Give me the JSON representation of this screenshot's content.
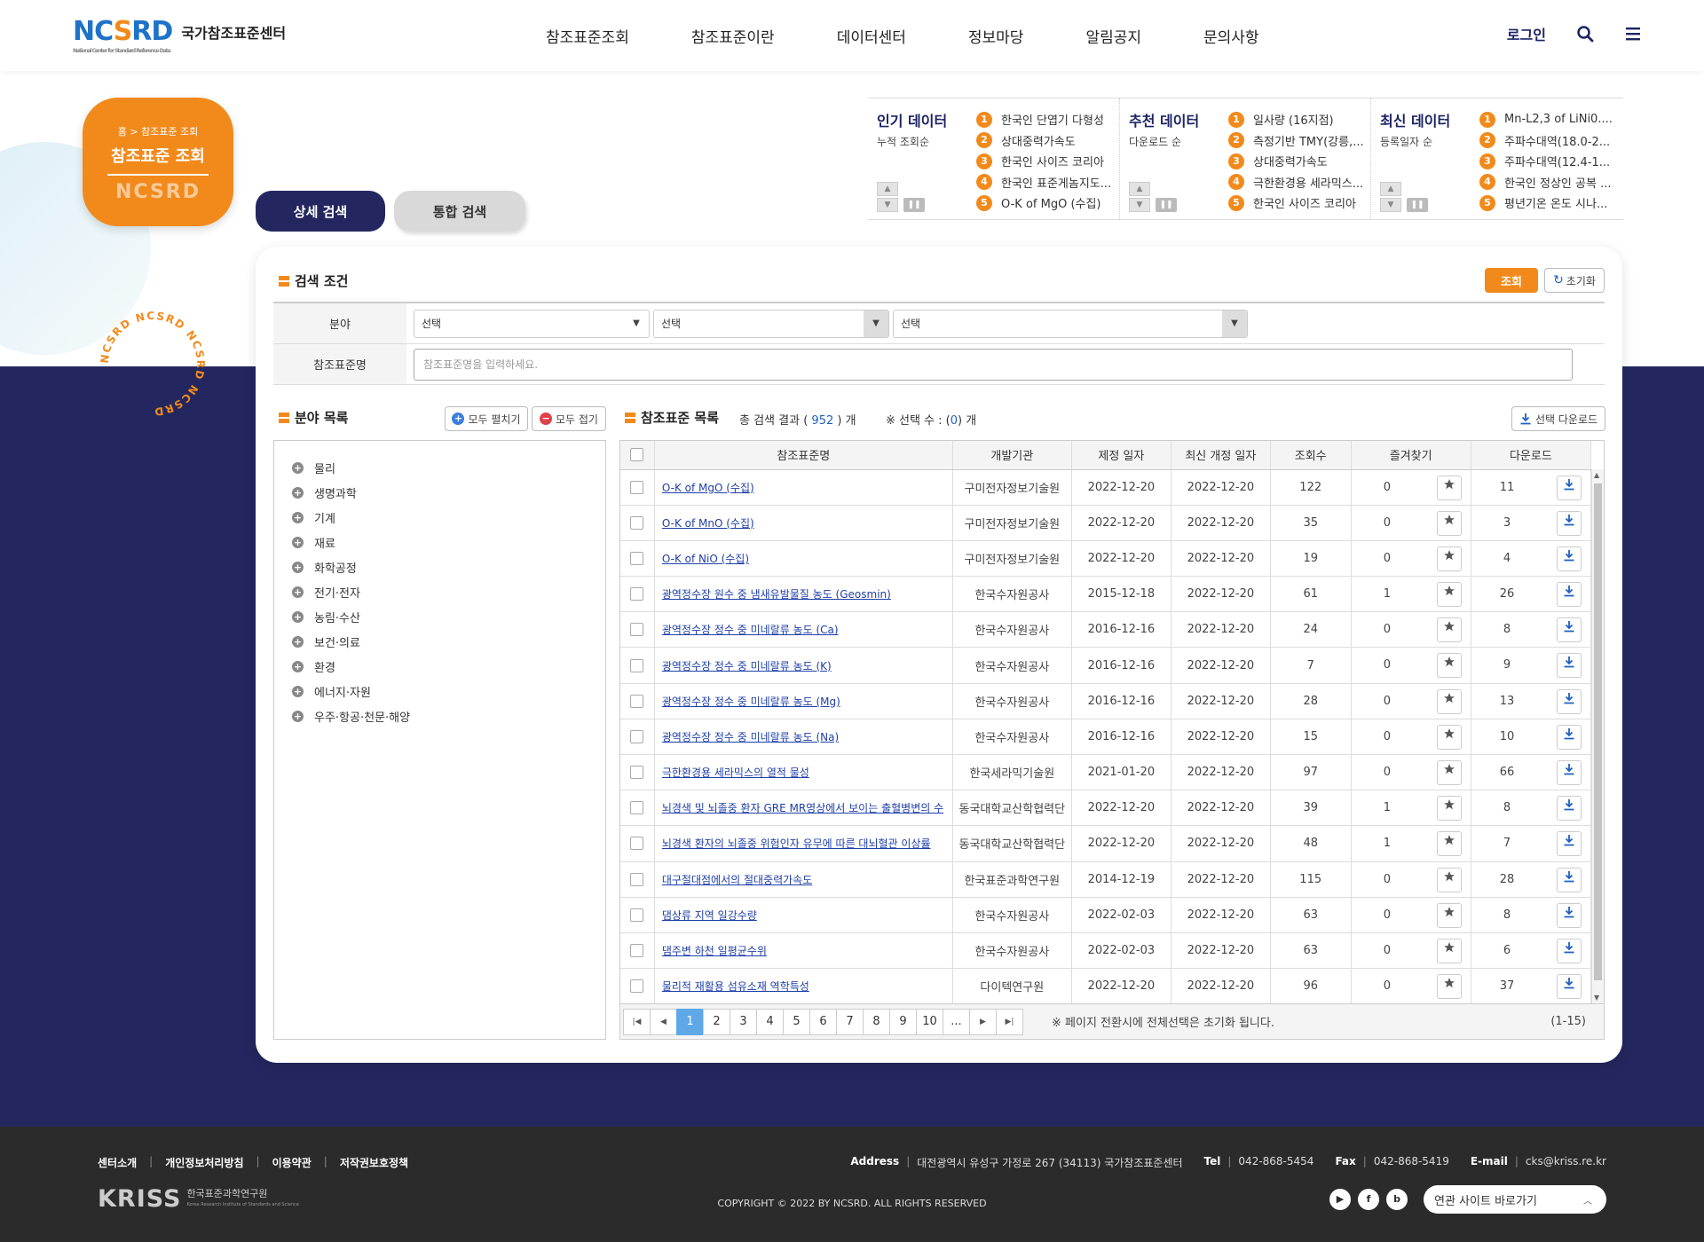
{
  "header": {
    "logo": {
      "text_a": "NC",
      "text_s": "S",
      "text_b": "RD",
      "sub": "National Center for Standard Reference Data",
      "name": "국가참조표준센터"
    },
    "menu": [
      "참조표준조회",
      "참조표준이란",
      "데이터센터",
      "정보마당",
      "알림공지",
      "문의사항"
    ],
    "login": "로그인"
  },
  "location": {
    "home": "홈",
    "current": "참조표준 조회",
    "title": "참조표준 조회",
    "watermark": "NCSRD"
  },
  "stamp_text": "NCSRD NCSRD NCSRD NCSRD",
  "search_tabs": {
    "detail": "상세 검색",
    "integrated": "통합 검색"
  },
  "rankings": [
    {
      "title": "인기 데이터",
      "sub": "누적 조회순",
      "items": [
        "한국인 단엽기 다형성",
        "상대중력가속도",
        "한국인 사이즈 코리아",
        "한국인 표준게놈지도...",
        "O-K of MgO (수집)"
      ]
    },
    {
      "title": "추천 데이터",
      "sub": "다운로드 순",
      "items": [
        "일사량 (16지점)",
        "측정기반 TMY(강릉,...",
        "상대중력가속도",
        "극한환경용 세라믹스...",
        "한국인 사이즈 코리아"
      ]
    },
    {
      "title": "최신 데이터",
      "sub": "등록일자 순",
      "items": [
        "Mn-L2,3 of LiNi0....",
        "주파수대역(18.0-2...",
        "주파수대역(12.4-1...",
        "한국인 정상인 공복 ...",
        "평년기온 온도 시나..."
      ]
    }
  ],
  "ranking_numbers": [
    "1",
    "2",
    "3",
    "4",
    "5"
  ],
  "condition": {
    "title": "검색 조건",
    "search_btn": "조회",
    "reset_btn": "초기화",
    "field_label": "분야",
    "select_values": [
      "선택",
      "선택",
      "선택"
    ],
    "name_label": "참조표준명",
    "name_placeholder": "참조표준명을 입력하세요."
  },
  "field_list": {
    "title": "분야 목록",
    "expand": "모두 펼치기",
    "collapse": "모두 접기",
    "items": [
      "물리",
      "생명과학",
      "기계",
      "재료",
      "화학공정",
      "전기·전자",
      "농림·수산",
      "보건·의료",
      "환경",
      "에너지·자원",
      "우주·항공·천문·해양"
    ]
  },
  "list": {
    "title": "참조표준 목록",
    "total_label": "총 검색 결과 (",
    "total": "952",
    "total_suffix": ") 개",
    "selected_label": "※ 선택 수 : (",
    "selected": "0",
    "selected_suffix": ") 개",
    "download_selected": "선택 다운로드",
    "columns": [
      "참조표준명",
      "개발기관",
      "제정 일자",
      "최신 개정 일자",
      "조회수",
      "즐겨찾기",
      "다운로드"
    ],
    "rows": [
      {
        "name": "O-K of MgO (수집)",
        "org": "구미전자정보기술원",
        "date": "2022-12-20",
        "rev": "2022-12-20",
        "views": "122",
        "fav": "0",
        "dl": "11"
      },
      {
        "name": "O-K of MnO (수집)",
        "org": "구미전자정보기술원",
        "date": "2022-12-20",
        "rev": "2022-12-20",
        "views": "35",
        "fav": "0",
        "dl": "3"
      },
      {
        "name": "O-K of NiO (수집)",
        "org": "구미전자정보기술원",
        "date": "2022-12-20",
        "rev": "2022-12-20",
        "views": "19",
        "fav": "0",
        "dl": "4"
      },
      {
        "name": "광역정수장 원수 중 냄새유발물질 농도 (Geosmin)",
        "org": "한국수자원공사",
        "date": "2015-12-18",
        "rev": "2022-12-20",
        "views": "61",
        "fav": "1",
        "dl": "26"
      },
      {
        "name": "광역정수장 정수 중 미네랄류 농도 (Ca)",
        "org": "한국수자원공사",
        "date": "2016-12-16",
        "rev": "2022-12-20",
        "views": "24",
        "fav": "0",
        "dl": "8"
      },
      {
        "name": "광역정수장 정수 중 미네랄류 농도 (K)",
        "org": "한국수자원공사",
        "date": "2016-12-16",
        "rev": "2022-12-20",
        "views": "7",
        "fav": "0",
        "dl": "9"
      },
      {
        "name": "광역정수장 정수 중 미네랄류 농도 (Mg)",
        "org": "한국수자원공사",
        "date": "2016-12-16",
        "rev": "2022-12-20",
        "views": "28",
        "fav": "0",
        "dl": "13"
      },
      {
        "name": "광역정수장 정수 중 미네랄류 농도 (Na)",
        "org": "한국수자원공사",
        "date": "2016-12-16",
        "rev": "2022-12-20",
        "views": "15",
        "fav": "0",
        "dl": "10"
      },
      {
        "name": "극한환경용 세라믹스의 열적 물성",
        "org": "한국세라믹기술원",
        "date": "2021-01-20",
        "rev": "2022-12-20",
        "views": "97",
        "fav": "0",
        "dl": "66"
      },
      {
        "name": "뇌경색 및 뇌졸중 환자 GRE MR영상에서 보이는 출혈병변의 수",
        "org": "동국대학교산학협력단",
        "date": "2022-12-20",
        "rev": "2022-12-20",
        "views": "39",
        "fav": "1",
        "dl": "8"
      },
      {
        "name": "뇌경색 환자의 뇌졸중 위험인자 유무에 따른 대뇌혈관 이상률",
        "org": "동국대학교산학협력단",
        "date": "2022-12-20",
        "rev": "2022-12-20",
        "views": "48",
        "fav": "1",
        "dl": "7"
      },
      {
        "name": "대구절대점에서의 절대중력가속도",
        "org": "한국표준과학연구원",
        "date": "2014-12-19",
        "rev": "2022-12-20",
        "views": "115",
        "fav": "0",
        "dl": "28"
      },
      {
        "name": "댐상류 지역 일강수량",
        "org": "한국수자원공사",
        "date": "2022-02-03",
        "rev": "2022-12-20",
        "views": "63",
        "fav": "0",
        "dl": "8"
      },
      {
        "name": "댐주변 하천 일평균수위",
        "org": "한국수자원공사",
        "date": "2022-02-03",
        "rev": "2022-12-20",
        "views": "63",
        "fav": "0",
        "dl": "6"
      },
      {
        "name": "물리적 재활용 섬유소재 역학특성",
        "org": "다이텍연구원",
        "date": "2022-12-20",
        "rev": "2022-12-20",
        "views": "96",
        "fav": "0",
        "dl": "37"
      }
    ],
    "pages": [
      "1",
      "2",
      "3",
      "4",
      "5",
      "6",
      "7",
      "8",
      "9",
      "10",
      "..."
    ],
    "current_page": "1",
    "page_note": "※ 페이지 전환시에 전체선택은 초기화 됩니다.",
    "page_range": "(1-15)"
  },
  "footer": {
    "links": [
      "센터소개",
      "개인정보처리방침",
      "이용약관",
      "저작권보호정책"
    ],
    "address_label": "Address",
    "address": "대전광역시 유성구 가정로 267 (34113) 국가참조표준센터",
    "tel_label": "Tel",
    "tel": "042-868-5454",
    "fax_label": "Fax",
    "fax": "042-868-5419",
    "email_label": "E-mail",
    "email": "cks@kriss.re.kr",
    "kriss_logo": "KRISS",
    "kriss_name": "한국표준과학연구원",
    "kriss_en": "Korea Research Institute of Standards and Science",
    "copyright": "COPYRIGHT © 2022 BY NCSRD. ALL RIGHTS RESERVED",
    "related": "연관 사이트 바로가기"
  }
}
